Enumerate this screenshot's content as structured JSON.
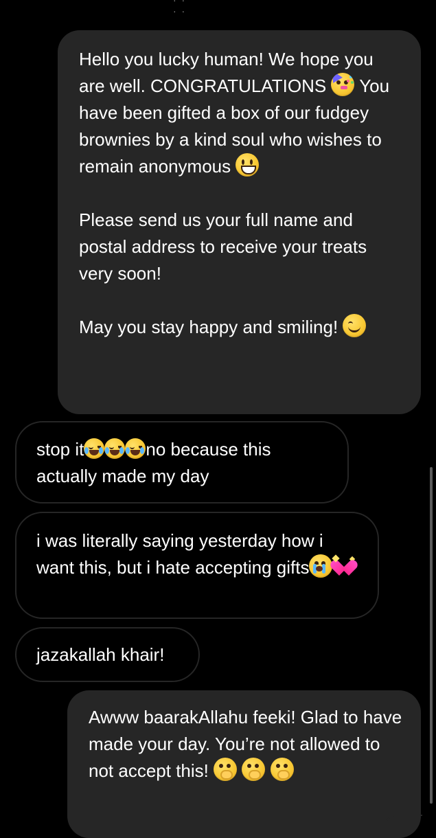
{
  "conversation": {
    "messages": [
      {
        "direction": "sent",
        "segments": [
          {
            "text": "Hello you lucky human! We hope you are well. CONGRATULATIONS "
          },
          {
            "emoji": "party-face-emoji"
          },
          {
            "text": " You have been gifted a box of our fudgey brownies by a kind soul who wishes to remain anonymous "
          },
          {
            "emoji": "grinning-face-emoji"
          },
          {
            "text": "Please send us your full name and postal address to receive your treats very soon!"
          },
          {
            "text": "May you stay happy and smiling! "
          },
          {
            "emoji": "smiling-face-emoji"
          }
        ]
      },
      {
        "direction": "received",
        "segments": [
          {
            "text": "stop it"
          },
          {
            "emoji": "tears-of-joy-emoji"
          },
          {
            "emoji": "tears-of-joy-emoji"
          },
          {
            "emoji": "tears-of-joy-emoji"
          },
          {
            "text": "no because this actually made my day"
          }
        ]
      },
      {
        "direction": "received",
        "segments": [
          {
            "text": "i was literally saying yesterday how i want this, but i hate accepting gifts"
          },
          {
            "emoji": "loudly-crying-face-emoji"
          },
          {
            "emoji": "sparkling-heart-emoji"
          }
        ]
      },
      {
        "direction": "received",
        "segments": [
          {
            "text": "jazakallah khair!"
          }
        ]
      },
      {
        "direction": "sent",
        "segments": [
          {
            "text": "Awww baarakAllahu feeki! Glad to have made your day. You’re not allowed to not accept this! "
          },
          {
            "emoji": "hand-over-mouth-emoji"
          },
          {
            "emoji": "hand-over-mouth-emoji"
          },
          {
            "emoji": "hand-over-mouth-emoji"
          }
        ]
      }
    ]
  }
}
